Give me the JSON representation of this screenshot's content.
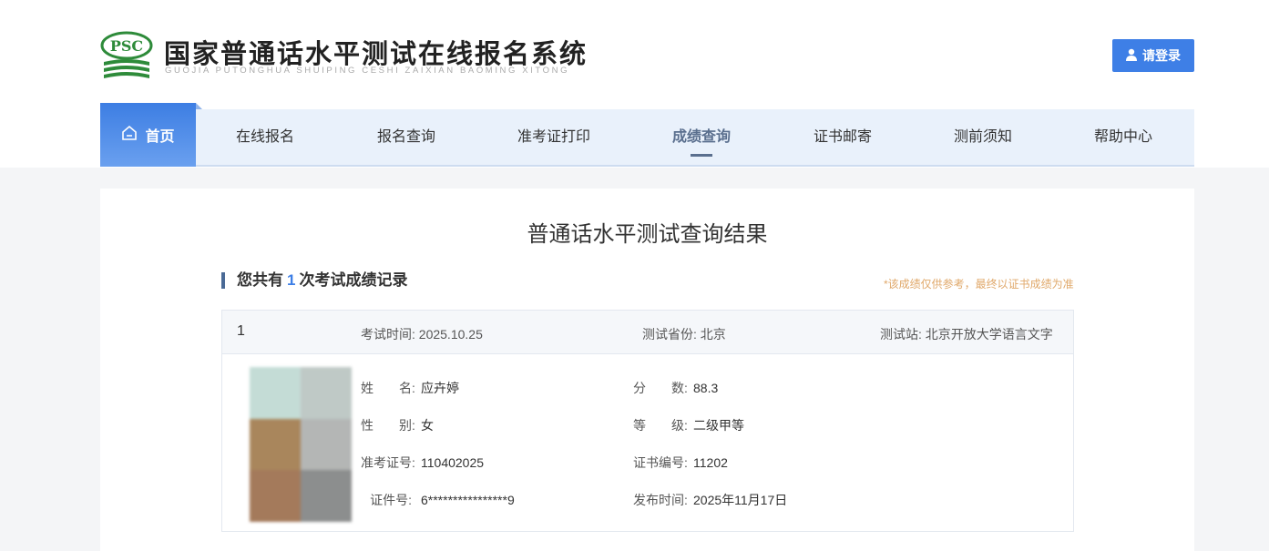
{
  "header": {
    "logo_text": "PSC",
    "site_title": "国家普通话水平测试在线报名系统",
    "site_subtitle": "GUOJIA PUTONGHUA SHUIPING CESHI ZAIXIAN BAOMING XITONG",
    "login_label": "请登录"
  },
  "nav": {
    "home_label": "首页",
    "items": [
      "在线报名",
      "报名查询",
      "准考证打印",
      "成绩查询",
      "证书邮寄",
      "测前须知",
      "帮助中心"
    ],
    "active": "成绩查询"
  },
  "result": {
    "title": "普通话水平测试查询结果",
    "summary_prefix": "您共有",
    "summary_count": "1",
    "summary_suffix": "次考试成绩记录",
    "note": "*该成绩仅供参考，最终以证书成绩为准"
  },
  "record": {
    "index": "1",
    "exam_time_label": "考试时间:",
    "exam_time": "2025.10.25",
    "province_label": "测试省份:",
    "province": "北京",
    "station_label": "测试站:",
    "station": "北京开放大学语言文字",
    "name_label": "姓　　名:",
    "name": "应卉婷",
    "gender_label": "性　　别:",
    "gender": "女",
    "ticket_label": "准考证号:",
    "ticket": "110402025",
    "id_label": "证件号:",
    "id_number": "6****************9",
    "score_label": "分　　数:",
    "score": "88.3",
    "level_label": "等　　级:",
    "level": "二级甲等",
    "cert_label": "证书编号:",
    "cert": "11202",
    "publish_label": "发布时间:",
    "publish": "2025年11月17日"
  },
  "colors": {
    "brand_blue": "#3e7fe6",
    "logo_green": "#2e8b3a",
    "nav_bg": "#e9f1fb",
    "note_orange": "#e0a86a"
  }
}
